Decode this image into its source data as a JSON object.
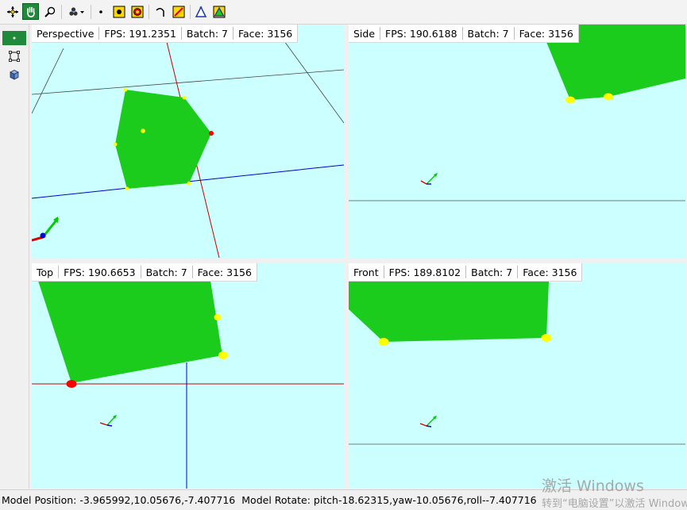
{
  "toolbar": {
    "buttons": [
      {
        "name": "move-tool",
        "icon": "crosshair-move-icon"
      },
      {
        "name": "pan-tool",
        "icon": "hand-icon",
        "active": true
      },
      {
        "name": "zoom-tool",
        "icon": "magnifier-icon"
      },
      {
        "name": "light-dropdown",
        "icon": "points-dropdown-icon"
      },
      {
        "name": "point-tool",
        "icon": "dot-icon"
      },
      {
        "name": "vertex-tool",
        "icon": "yellow-dot-icon"
      },
      {
        "name": "bullseye-tool",
        "icon": "bullseye-icon"
      },
      {
        "name": "curve-tool",
        "icon": "curve-icon"
      },
      {
        "name": "line-tool",
        "icon": "line-icon"
      },
      {
        "name": "triangle-outline-tool",
        "icon": "triangle-outline-icon"
      },
      {
        "name": "triangle-filled-tool",
        "icon": "triangle-filled-icon"
      }
    ]
  },
  "leftbar": {
    "buttons": [
      {
        "name": "select-tool",
        "icon": "select-dot-icon",
        "active": true
      },
      {
        "name": "bounding-box-tool",
        "icon": "bounding-box-icon"
      },
      {
        "name": "shade-tool",
        "icon": "cube-icon"
      }
    ]
  },
  "viewports": [
    {
      "name": "Perspective",
      "fps": "FPS: 191.2351",
      "batch": "Batch: 7",
      "face": "Face: 3156"
    },
    {
      "name": "Side",
      "fps": "FPS: 190.6188",
      "batch": "Batch: 7",
      "face": "Face: 3156"
    },
    {
      "name": "Top",
      "fps": "FPS: 190.6653",
      "batch": "Batch: 7",
      "face": "Face: 3156"
    },
    {
      "name": "Front",
      "fps": "FPS: 189.8102",
      "batch": "Batch: 7",
      "face": "Face: 3156"
    }
  ],
  "status": {
    "position": "Model Position: -3.965992,10.05676,-7.407716",
    "rotate": "Model Rotate: pitch-18.62315,yaw-10.05676,roll--7.407716"
  },
  "watermark": {
    "line1": "激活 Windows",
    "line2": "转到“电脑设置”以激活 Windows"
  },
  "colors": {
    "viewport_bg": "#ccffff",
    "mesh": "#1ccc1c",
    "vertex": "#ffff00",
    "selected_vertex": "#ff0000",
    "axis_x": "#cc0000",
    "axis_z": "#0000cc",
    "active_tool": "#1e8a3a"
  }
}
